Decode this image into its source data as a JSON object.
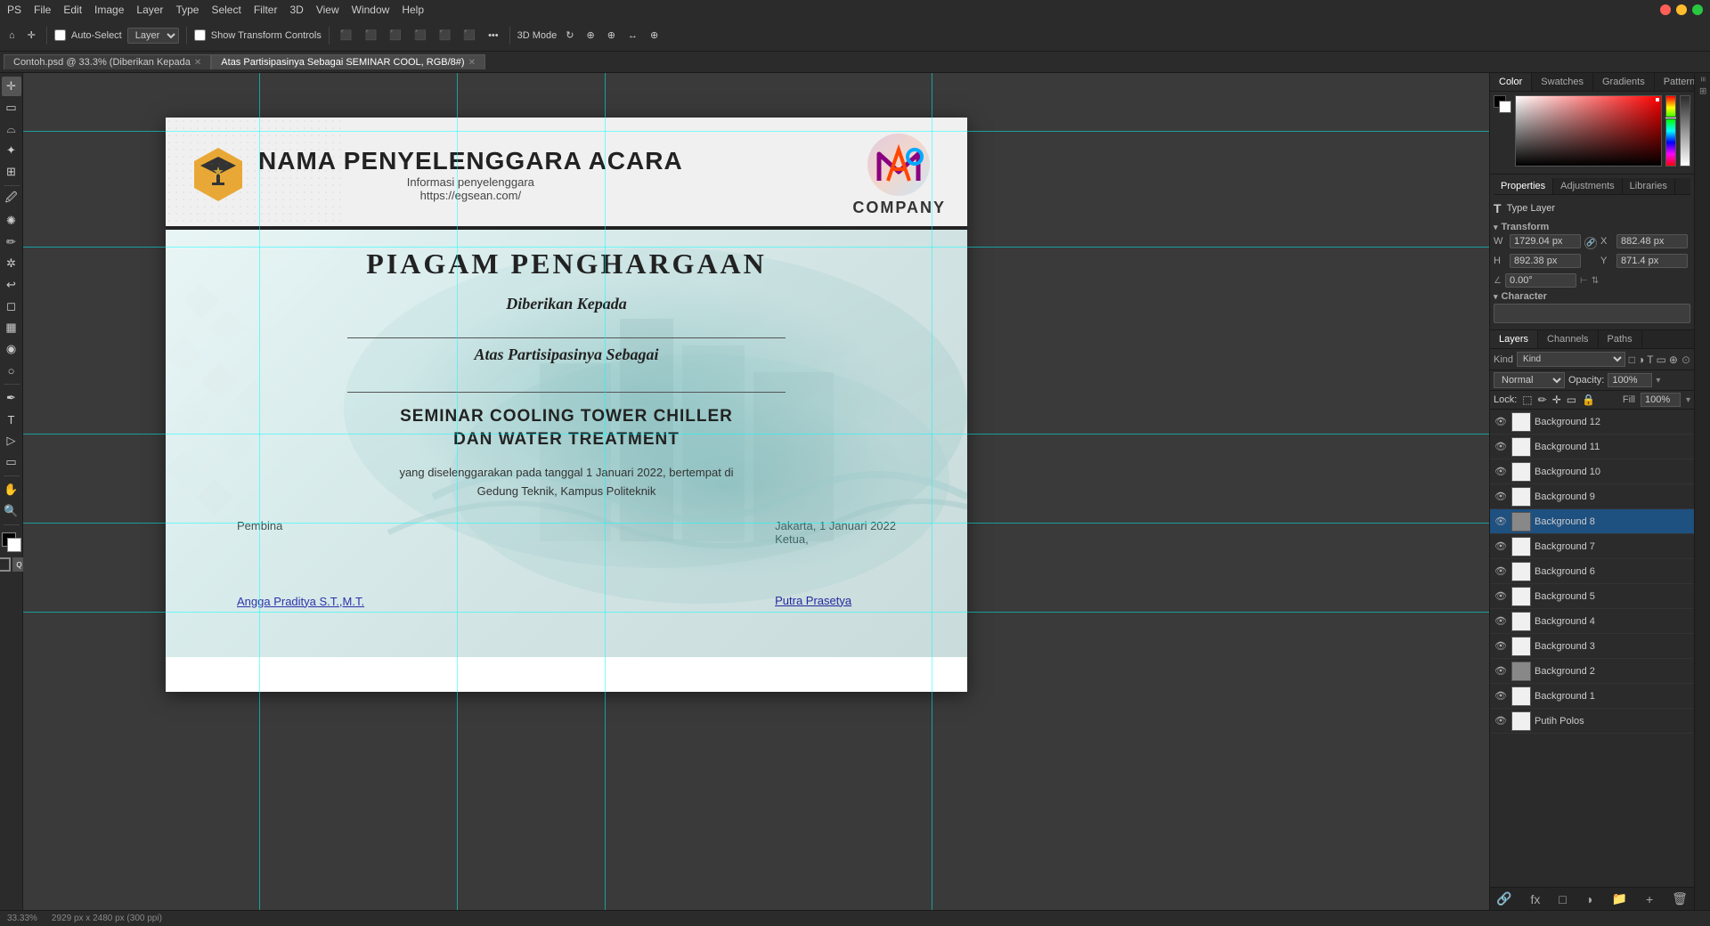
{
  "app": {
    "title": "Adobe Photoshop",
    "window_controls": [
      "close",
      "minimize",
      "maximize"
    ]
  },
  "menu": {
    "items": [
      "PS",
      "File",
      "Edit",
      "Image",
      "Layer",
      "Type",
      "Select",
      "Filter",
      "3D",
      "View",
      "Window",
      "Help"
    ]
  },
  "toolbar": {
    "auto_select_label": "Auto-Select",
    "layer_label": "Layer",
    "show_transform_label": "Show Transform Controls",
    "mode_3d_label": "3D Mode",
    "normal_label": "Normal"
  },
  "tabs": [
    {
      "label": "Contoh.psd @ 33.3% (Diberikan Kepada",
      "active": false
    },
    {
      "label": "Atas Partisipasinya Sebagai  SEMINAR COOL, RGB/8#)",
      "active": true
    }
  ],
  "certificate": {
    "org_name": "NAMA PENYELENGGARA ACARA",
    "org_info": "Informasi penyelenggara",
    "org_url": "https://egsean.com/",
    "company_name": "COMPANY",
    "piagam_title": "PIAGAM PENGHARGAAN",
    "diberikan_kepada": "Diberikan Kepada",
    "atas_partisipasinya": "Atas Partisipasinya Sebagai",
    "event_line1": "SEMINAR COOLING TOWER CHILLER",
    "event_line2": "DAN WATER TREATMENT",
    "details_line1": "yang diselenggarakan pada tanggal 1 Januari 2022, bertempat di",
    "details_line2": "Gedung Teknik, Kampus Politeknik",
    "sig_left_role": "Pembina",
    "sig_right_city_date": "Jakarta, 1 Januari 2022",
    "sig_right_role": "Ketua,",
    "sig_left_name": "Angga Praditya S.T.,M.T.",
    "sig_right_name": "Putra Prasetya"
  },
  "color_panel": {
    "tabs": [
      "Color",
      "Swatches",
      "Gradients",
      "Patterns"
    ],
    "active_tab": "Color"
  },
  "properties_panel": {
    "tabs": [
      "Properties",
      "Adjustments",
      "Libraries"
    ],
    "active_tab": "Properties",
    "type_layer_label": "Type Layer",
    "transform_label": "Transform",
    "w_label": "W",
    "w_value": "1729.04 px",
    "x_label": "X",
    "x_value": "882.48 px",
    "h_label": "H",
    "h_value": "892.38 px",
    "y_label": "Y",
    "y_value": "871.4 px",
    "angle_value": "0.00°",
    "character_label": "Character"
  },
  "layers_panel": {
    "tabs": [
      "Layers",
      "Channels",
      "Paths"
    ],
    "active_tab": "Layers",
    "kind_label": "Kind",
    "normal_label": "Normal",
    "opacity_label": "Opacity:",
    "opacity_value": "100%",
    "fill_label": "Fill",
    "fill_value": "100%",
    "lock_label": "Lock:",
    "layers": [
      {
        "name": "Background 12",
        "visible": true,
        "active": false,
        "thumb": "light"
      },
      {
        "name": "Background 11",
        "visible": true,
        "active": false,
        "thumb": "light"
      },
      {
        "name": "Background 10",
        "visible": true,
        "active": false,
        "thumb": "light"
      },
      {
        "name": "Background 9",
        "visible": true,
        "active": false,
        "thumb": "light"
      },
      {
        "name": "Background 8",
        "visible": true,
        "active": true,
        "thumb": "dark"
      },
      {
        "name": "Background 7",
        "visible": true,
        "active": false,
        "thumb": "light"
      },
      {
        "name": "Background 6",
        "visible": true,
        "active": false,
        "thumb": "light"
      },
      {
        "name": "Background 5",
        "visible": true,
        "active": false,
        "thumb": "light"
      },
      {
        "name": "Background 4",
        "visible": true,
        "active": false,
        "thumb": "light"
      },
      {
        "name": "Background 3",
        "visible": true,
        "active": false,
        "thumb": "light"
      },
      {
        "name": "Background 2",
        "visible": true,
        "active": false,
        "thumb": "dark"
      },
      {
        "name": "Background 1",
        "visible": true,
        "active": false,
        "thumb": "light"
      },
      {
        "name": "Putih Polos",
        "visible": true,
        "active": false,
        "thumb": "light"
      }
    ]
  },
  "status_bar": {
    "zoom": "33.33%",
    "doc_size": "2929 px x 2480 px (300 ppi)"
  }
}
